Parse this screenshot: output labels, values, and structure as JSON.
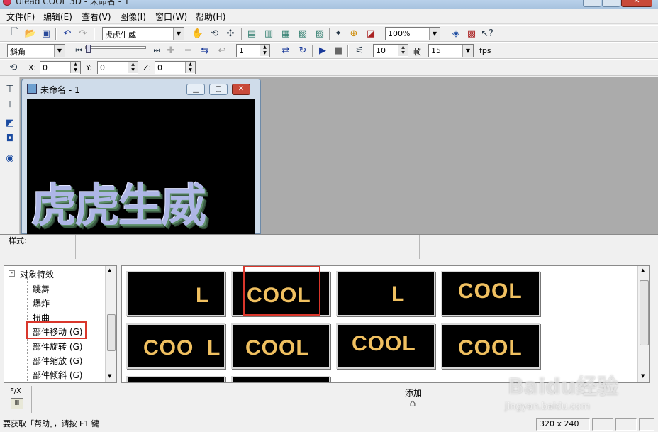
{
  "window": {
    "title": "Ulead COOL 3D - 未命名 - 1",
    "close_glyph": "✕"
  },
  "menu": [
    "文件(F)",
    "编辑(E)",
    "查看(V)",
    "图像(I)",
    "窗口(W)",
    "帮助(H)"
  ],
  "toolbar1": {
    "text_combo_value": "虎虎生威",
    "zoom_value": "100%"
  },
  "toolbar2": {
    "bevel_combo_value": "斜角",
    "frame_value": "1",
    "frame_count_value": "10",
    "frame_label": "帧",
    "fps_value": "15",
    "fps_label": "fps"
  },
  "toolbar3": {
    "x_label": "X:",
    "x_value": "0",
    "y_label": "Y:",
    "y_value": "0",
    "z_label": "Z:",
    "z_value": "0"
  },
  "document": {
    "title": "未命名 - 1",
    "canvas_text": "虎虎生威"
  },
  "style_bar": {
    "label": "样式:"
  },
  "effects_tree": {
    "root_label": "对象特效",
    "items": [
      {
        "label": "跳舞"
      },
      {
        "label": "爆炸"
      },
      {
        "label": "扭曲"
      },
      {
        "label": "部件移动 (G)",
        "highlighted": true
      },
      {
        "label": "部件旋转 (G)"
      },
      {
        "label": "部件缩放 (G)"
      },
      {
        "label": "部件倾斜 (G)"
      }
    ]
  },
  "gallery": {
    "thumbnails": [
      {
        "text": "L",
        "highlighted": false
      },
      {
        "text": "COOL",
        "highlighted": true
      },
      {
        "text": "L",
        "highlighted": false
      },
      {
        "text": "COOL",
        "highlighted": false
      },
      {
        "text": "COO  L",
        "highlighted": false
      },
      {
        "text": "COOL",
        "highlighted": false
      },
      {
        "text": "COOL",
        "highlighted": false
      },
      {
        "text": "COOL",
        "highlighted": false
      }
    ]
  },
  "fx_bar": {
    "fx_label": "F/X",
    "add_label": "添加"
  },
  "status": {
    "message": "要获取「帮助」，请按 F1 键",
    "canvas_size": "320 x 240"
  },
  "watermark": {
    "brand": "Baidu经验",
    "url": "jingyan.baidu.com"
  },
  "colors": {
    "highlight": "#d9362b",
    "thumb_text": "#f0c060",
    "workspace": "#ababab"
  }
}
